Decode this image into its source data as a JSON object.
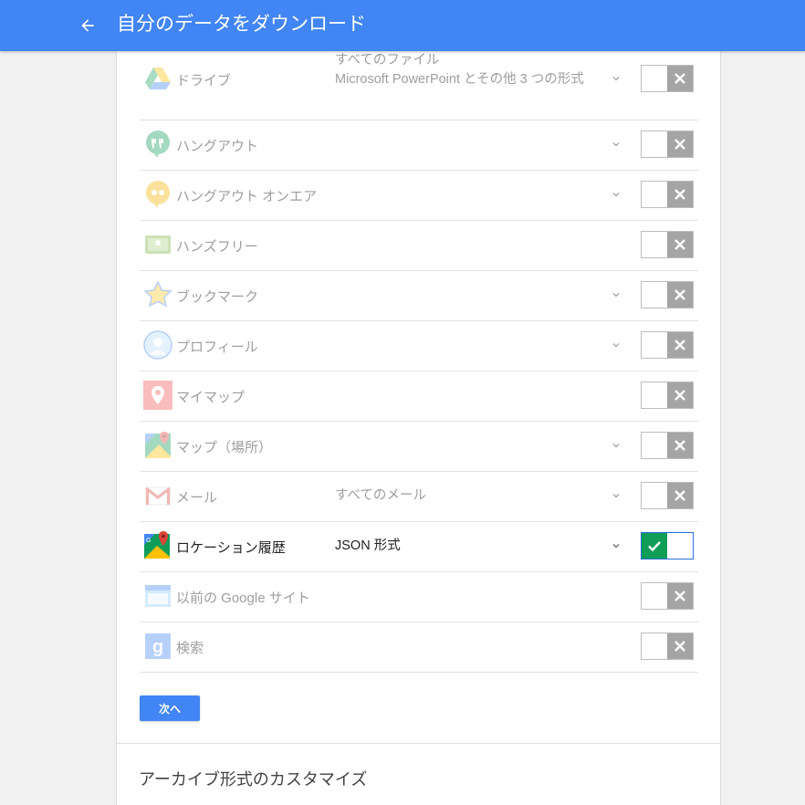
{
  "appbar": {
    "title": "自分のデータをダウンロード",
    "back_icon": "arrow-back-icon",
    "color": "#4285f4"
  },
  "products": [
    {
      "name": "ドライブ",
      "icon": "google-drive-icon",
      "desc": "すべてのファイル\nMicrosoft PowerPoint とその他 3 つの形式",
      "has_options": true,
      "enabled": false
    },
    {
      "name": "ハングアウト",
      "icon": "hangouts-icon",
      "desc": "",
      "has_options": true,
      "enabled": false
    },
    {
      "name": "ハングアウト オンエア",
      "icon": "hangouts-on-air-icon",
      "desc": "",
      "has_options": true,
      "enabled": false
    },
    {
      "name": "ハンズフリー",
      "icon": "hands-free-icon",
      "desc": "",
      "has_options": false,
      "enabled": false
    },
    {
      "name": "ブックマーク",
      "icon": "bookmarks-star-icon",
      "desc": "",
      "has_options": true,
      "enabled": false
    },
    {
      "name": "プロフィール",
      "icon": "profile-icon",
      "desc": "",
      "has_options": true,
      "enabled": false
    },
    {
      "name": "マイマップ",
      "icon": "my-maps-icon",
      "desc": "",
      "has_options": false,
      "enabled": false
    },
    {
      "name": "マップ（場所）",
      "icon": "maps-icon",
      "desc": "",
      "has_options": true,
      "enabled": false
    },
    {
      "name": "メール",
      "icon": "gmail-icon",
      "desc": "すべてのメール",
      "has_options": true,
      "enabled": false
    },
    {
      "name": "ロケーション履歴",
      "icon": "location-history-icon",
      "desc": "JSON 形式",
      "has_options": true,
      "enabled": true
    },
    {
      "name": "以前の Google サイト",
      "icon": "classic-sites-icon",
      "desc": "",
      "has_options": false,
      "enabled": false
    },
    {
      "name": "検索",
      "icon": "google-search-icon",
      "desc": "",
      "has_options": false,
      "enabled": false
    }
  ],
  "next_button": {
    "label": "次へ"
  },
  "customize_section": {
    "title": "アーカイブ形式のカスタマイズ"
  },
  "colors": {
    "enabled_check": "#0f9d58",
    "disabled_x": "#a5a5a5",
    "primary": "#4285f4"
  }
}
